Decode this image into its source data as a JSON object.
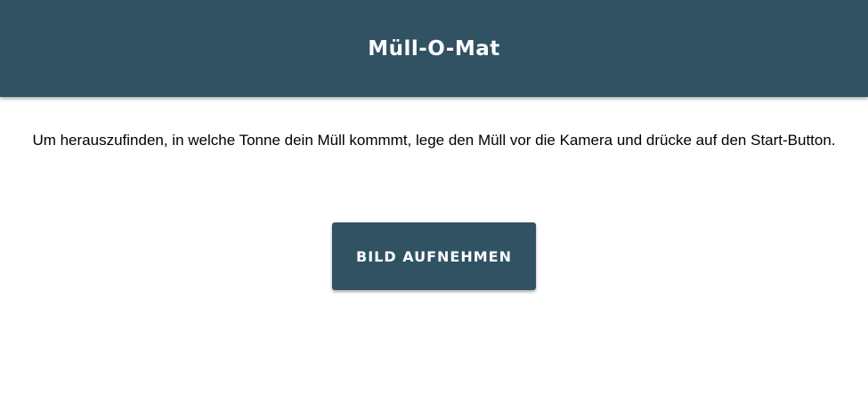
{
  "header": {
    "title": "Müll-O-Mat"
  },
  "main": {
    "instructions": "Um herauszufinden, in welche Tonne dein Müll kommmt, lege den Müll vor die Kamera und drücke auf den Start-Button.",
    "capture_button_label": "BILD AUFNEHMEN"
  },
  "colors": {
    "primary": "#305263",
    "text_on_primary": "#ffffff",
    "background": "#ffffff"
  }
}
